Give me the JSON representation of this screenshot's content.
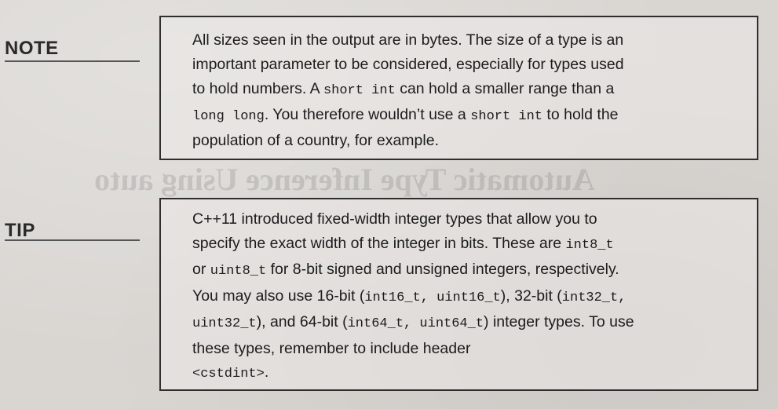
{
  "note": {
    "label": "NOTE",
    "lines": [
      {
        "text": "All sizes seen in the output are in bytes. The size of a type is an"
      },
      {
        "text": "important parameter to be considered, especially for types used"
      },
      {
        "pre": "to hold numbers. A ",
        "code": "short int",
        "post": " can hold a smaller range than a"
      },
      {
        "code": "long long",
        "post": ". You therefore wouldn’t use a ",
        "code2": "short int",
        "post2": " to hold the"
      },
      {
        "text": "population of a country, for example."
      }
    ]
  },
  "tip": {
    "label": "TIP",
    "lines": [
      {
        "text": "C++11 introduced fixed-width integer types that allow you to"
      },
      {
        "pre": "specify the exact width of the integer in bits. These are ",
        "code": "int8_t"
      },
      {
        "pre": "or ",
        "code": "uint8_t",
        "post": " for 8-bit signed and unsigned integers, respectively."
      },
      {
        "pre": "You may also use 16-bit (",
        "code": "int16_t, uint16_t",
        "post": "), 32-bit (",
        "code2": "int32_t,"
      },
      {
        "code": "uint32_t",
        "post": "), and 64-bit (",
        "code2": "int64_t, uint64_t",
        "post2": ") integer types. To use"
      },
      {
        "text": "these types, remember to include header"
      },
      {
        "code": "<cstdint>",
        "post": "."
      }
    ]
  },
  "background": {
    "heading_mirrored": "Automatic Type Inference Using auto"
  }
}
